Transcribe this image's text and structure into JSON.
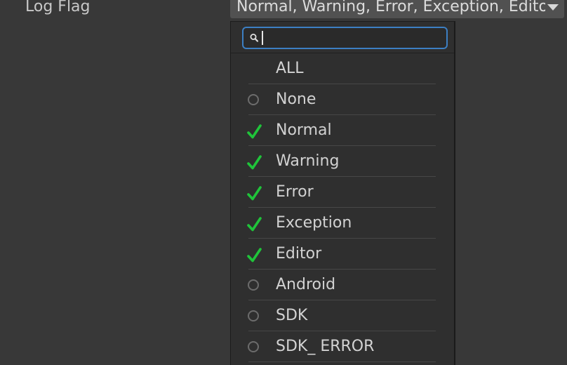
{
  "field": {
    "label": "Log Flag",
    "value": "Normal, Warning, Error, Exception, Editor, SDK_ERROR"
  },
  "search": {
    "value": "",
    "icon": "search-icon"
  },
  "colors": {
    "check": "#1fc43a",
    "search_border": "#3c7fc3",
    "popup_bg": "#2f2f2f"
  },
  "options": [
    {
      "label": "ALL",
      "state": "none"
    },
    {
      "label": "None",
      "state": "unchecked"
    },
    {
      "label": "Normal",
      "state": "checked"
    },
    {
      "label": "Warning",
      "state": "checked"
    },
    {
      "label": "Error",
      "state": "checked"
    },
    {
      "label": "Exception",
      "state": "checked"
    },
    {
      "label": "Editor",
      "state": "checked"
    },
    {
      "label": "Android",
      "state": "unchecked"
    },
    {
      "label": "SDK",
      "state": "unchecked"
    },
    {
      "label": "SDK_ ERROR",
      "state": "unchecked"
    }
  ]
}
